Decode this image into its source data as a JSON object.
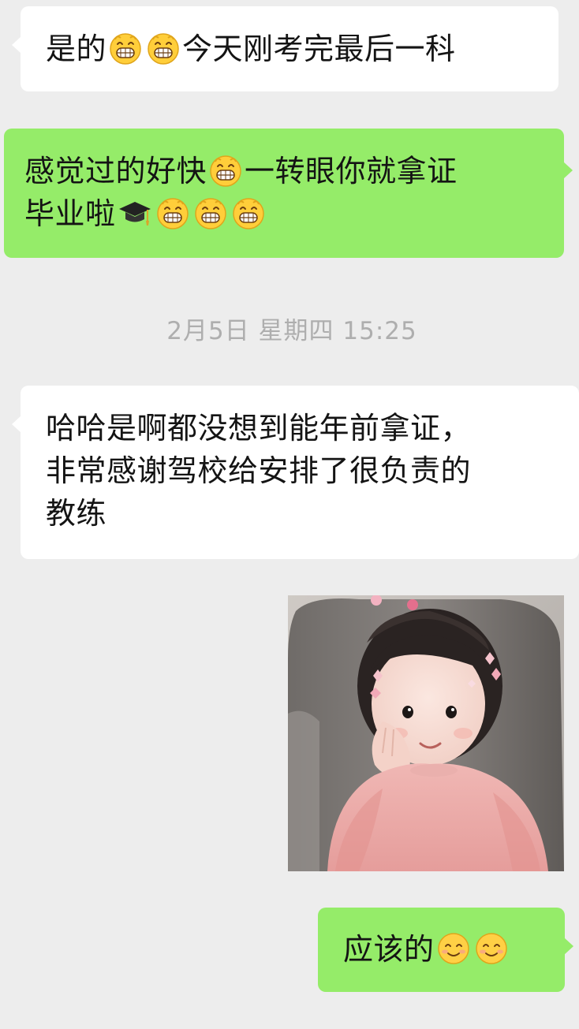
{
  "chat": {
    "messages": [
      {
        "direction": "incoming",
        "segments": [
          "是的",
          "",
          "",
          "今天刚考完最后一科"
        ]
      },
      {
        "direction": "outgoing",
        "line1": [
          "感觉过的好快",
          "",
          "一转眼你就拿证"
        ],
        "line2": [
          "毕业啦",
          "",
          "",
          "",
          ""
        ]
      },
      {
        "direction": "incoming",
        "lines": [
          "哈哈是啊都没想到能年前拿证，",
          "非常感谢驾校给安排了很负责的",
          "教练"
        ]
      },
      {
        "direction": "outgoing",
        "type": "image",
        "image_icon": "girl-hand-on-cheek-photo"
      },
      {
        "direction": "outgoing",
        "segments": [
          "应该的",
          "",
          ""
        ]
      }
    ],
    "timestamp": "2月5日 星期四 15:25"
  },
  "icons": {
    "grin": "grinning-face-icon",
    "grad_cap": "graduation-cap-icon",
    "smile": "smiling-face-icon"
  },
  "colors": {
    "background": "#ededed",
    "incoming_bubble": "#ffffff",
    "outgoing_bubble": "#95ec69",
    "timestamp_text": "#aeaeae"
  }
}
